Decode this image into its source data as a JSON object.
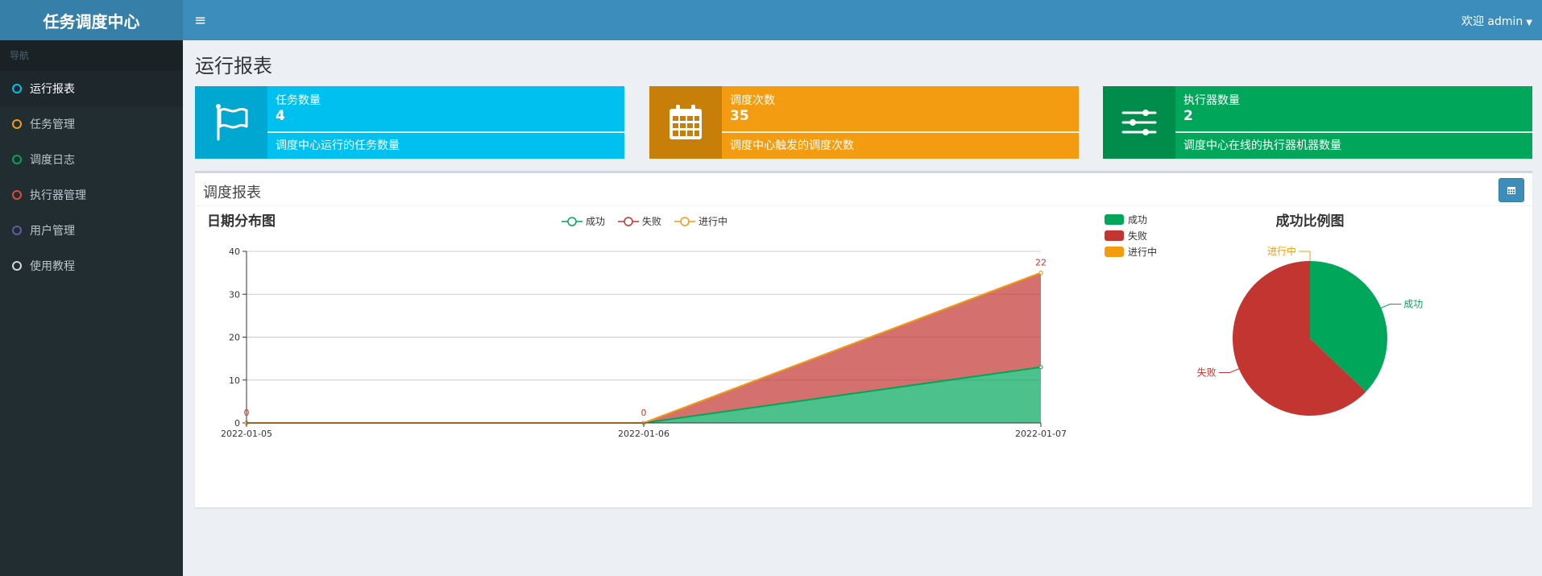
{
  "app": {
    "title": "任务调度中心"
  },
  "sidebar": {
    "header": "导航",
    "items": [
      {
        "label": "运行报表",
        "color": "#00c0ef",
        "active": true
      },
      {
        "label": "任务管理",
        "color": "#f39c12"
      },
      {
        "label": "调度日志",
        "color": "#00a65a"
      },
      {
        "label": "执行器管理",
        "color": "#dd4b39"
      },
      {
        "label": "用户管理",
        "color": "#605ca8"
      },
      {
        "label": "使用教程",
        "color": "#d2d6de"
      }
    ]
  },
  "header": {
    "menu_icon": "≡",
    "user_label": "欢迎 admin"
  },
  "page": {
    "title": "运行报表"
  },
  "info_boxes": [
    {
      "label": "任务数量",
      "number": "4",
      "desc": "调度中心运行的任务数量",
      "icon": "flag-icon",
      "color": "#00c0ef",
      "icon_bg": "#00a7d0"
    },
    {
      "label": "调度次数",
      "number": "35",
      "desc": "调度中心触发的调度次数",
      "icon": "calendar-icon",
      "color": "#f39c12",
      "icon_bg": "#c87f0a"
    },
    {
      "label": "执行器数量",
      "number": "2",
      "desc": "调度中心在线的执行器机器数量",
      "icon": "sliders-icon",
      "color": "#00a65a",
      "icon_bg": "#008d4c"
    }
  ],
  "report": {
    "title": "调度报表",
    "calendar_icon": "calendar-icon"
  },
  "chart_data": [
    {
      "type": "area",
      "title": "日期分布图",
      "stacked": true,
      "x": [
        "2022-01-05",
        "2022-01-06",
        "2022-01-07"
      ],
      "ylim": [
        0,
        40
      ],
      "yticks": [
        0,
        10,
        20,
        30,
        40
      ],
      "grid": true,
      "legend_position": "top",
      "series": [
        {
          "name": "成功",
          "values": [
            0,
            0,
            13
          ],
          "color": "#00a65a"
        },
        {
          "name": "失败",
          "values": [
            0,
            0,
            22
          ],
          "color": "#c23531"
        },
        {
          "name": "进行中",
          "values": [
            0,
            0,
            0
          ],
          "color": "#f39c12"
        }
      ],
      "data_labels": [
        "0",
        "0",
        "22"
      ]
    },
    {
      "type": "pie",
      "title": "成功比例图",
      "legend_position": "top-left",
      "slices": [
        {
          "name": "成功",
          "value": 13,
          "color": "#00a65a"
        },
        {
          "name": "失败",
          "value": 22,
          "color": "#c23531"
        },
        {
          "name": "进行中",
          "value": 0,
          "color": "#f39c12"
        }
      ]
    }
  ]
}
